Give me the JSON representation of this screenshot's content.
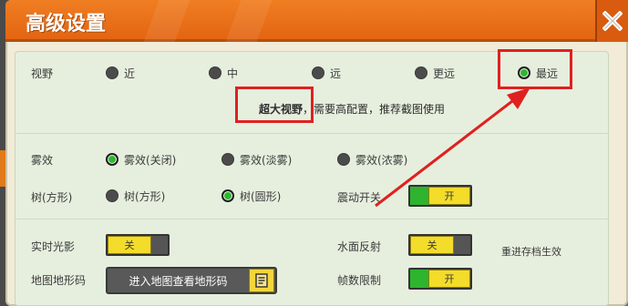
{
  "window": {
    "title": "高级设置"
  },
  "view": {
    "label": "视野",
    "options": [
      "近",
      "中",
      "远",
      "更远",
      "最远"
    ],
    "selected_index": 4,
    "note_emph": "超大视野",
    "note_rest": "，需要高配置，推荐截图使用"
  },
  "fog": {
    "label": "雾效",
    "options": [
      "雾效(关闭)",
      "雾效(淡雾)",
      "雾效(浓雾)"
    ],
    "selected_index": 0
  },
  "tree": {
    "label": "树(方形)",
    "options": [
      "树(方形)",
      "树(圆形)"
    ],
    "selected_index": 1
  },
  "vibration": {
    "label": "震动开关",
    "state": "开",
    "on": true
  },
  "realtime_light": {
    "label": "实时光影",
    "state": "关",
    "on": false
  },
  "water_reflect": {
    "label": "水面反射",
    "state": "关",
    "on": false,
    "hint": "重进存档生效"
  },
  "terrain_code": {
    "label": "地图地形码",
    "button": "进入地图查看地形码"
  },
  "fps_limit": {
    "label": "帧数限制",
    "state": "开",
    "on": true
  },
  "colors": {
    "title_bar": "#e86d16",
    "panel_bg": "#e6efde",
    "radio_on": "#2fb82f",
    "toggle_knob": "#f3dc2a",
    "toggle_on": "#2eb42e",
    "annotation": "#e02020"
  },
  "icons": {
    "close": "close-icon",
    "terrain": "document-icon"
  }
}
